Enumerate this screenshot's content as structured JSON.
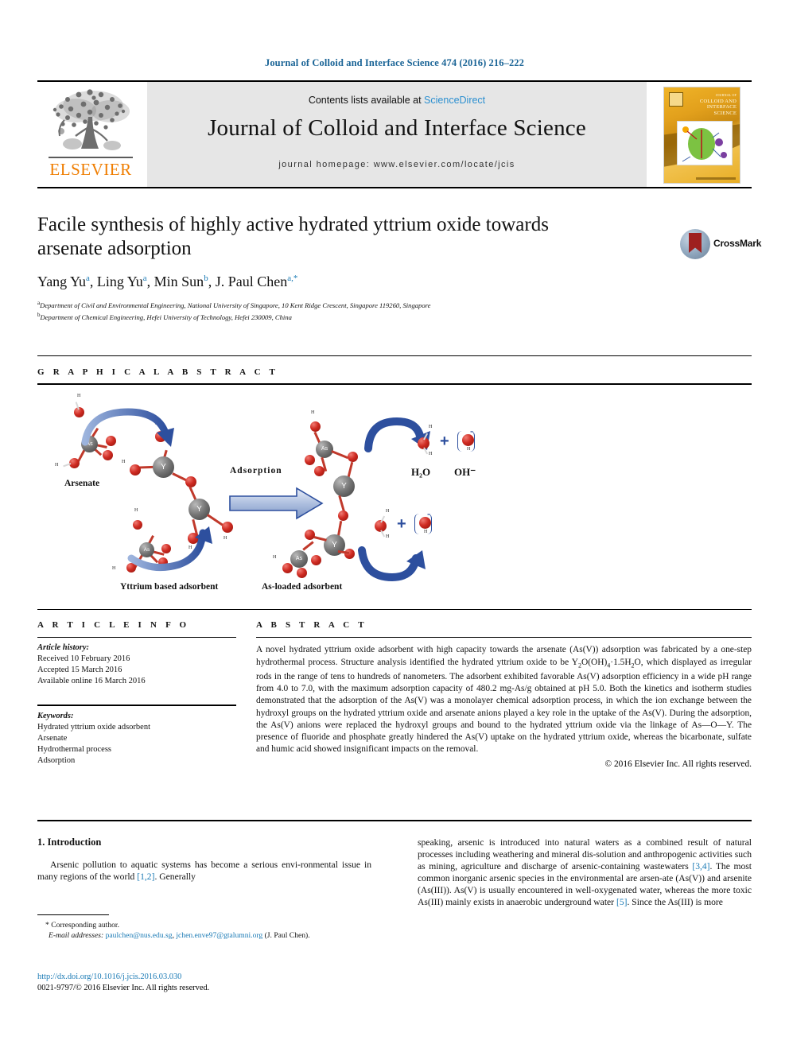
{
  "running_head": "Journal of Colloid and Interface Science 474 (2016) 216–222",
  "masthead": {
    "contents_prefix": "Contents lists available at ",
    "sciencedirect": "ScienceDirect",
    "journal_title": "Journal of Colloid and Interface Science",
    "homepage": "journal homepage: www.elsevier.com/locate/jcis",
    "publisher_wordmark": "ELSEVIER",
    "cover_title_line1": "JOURNAL OF",
    "cover_title_line2": "COLLOID AND",
    "cover_title_line3": "INTERFACE",
    "cover_title_line4": "SCIENCE"
  },
  "article": {
    "title": "Facile synthesis of highly active hydrated yttrium oxide towards arsenate adsorption",
    "authors": [
      {
        "name": "Yang Yu",
        "sup": "a"
      },
      {
        "name": "Ling Yu",
        "sup": "a"
      },
      {
        "name": "Min Sun",
        "sup": "b"
      },
      {
        "name": "J. Paul Chen",
        "sup": "a,*"
      }
    ],
    "affiliations": [
      {
        "mark": "a",
        "text": "Department of Civil and Environmental Engineering, National University of Singapore, 10 Kent Ridge Crescent, Singapore 119260, Singapore"
      },
      {
        "mark": "b",
        "text": "Department of Chemical Engineering, Hefei University of Technology, Hefei 230009, China"
      }
    ],
    "crossmark_label": "CrossMark"
  },
  "graphical_abstract": {
    "heading": "G R A P H I C A L   A B S T R A C T",
    "labels": {
      "arsenate": "Arsenate",
      "adsorbent": "Yttrium based adsorbent",
      "adsorption": "Adsorption",
      "loaded": "As-loaded adsorbent",
      "water": "H₂O",
      "hydroxide": "OH⁻",
      "atom_as": "As",
      "atom_y": "Y",
      "atom_h": "H",
      "atom_o": "O",
      "plus": "+",
      "minus": "-"
    }
  },
  "article_info": {
    "heading": "A R T I C L E   I N F O",
    "history_label": "Article history:",
    "history": [
      "Received 10 February 2016",
      "Accepted 15 March 2016",
      "Available online 16 March 2016"
    ],
    "keywords_label": "Keywords:",
    "keywords": [
      "Hydrated yttrium oxide adsorbent",
      "Arsenate",
      "Hydrothermal process",
      "Adsorption"
    ]
  },
  "abstract": {
    "heading": "A B S T R A C T",
    "part1": "A novel hydrated yttrium oxide adsorbent with high capacity towards the arsenate (As(V)) adsorption was fabricated by a one-step hydrothermal process. Structure analysis identified the hydrated yttrium oxide to be Y",
    "formula_1": "2",
    "part2": "O(OH)",
    "formula_2": "4",
    "part3": "·1.5H",
    "formula_3": "2",
    "part4": "O, which displayed as irregular rods in the range of tens to hundreds of nanometers. The adsorbent exhibited favorable As(V) adsorption efficiency in a wide pH range from 4.0 to 7.0, with the maximum adsorption capacity of 480.2 mg-As/g obtained at pH 5.0. Both the kinetics and isotherm studies demonstrated that the adsorption of the As(V) was a monolayer chemical adsorption process, in which the ion exchange between the hydroxyl groups on the hydrated yttrium oxide and arsenate anions played a key role in the uptake of the As(V). During the adsorption, the As(V) anions were replaced the hydroxyl groups and bound to the hydrated yttrium oxide via the linkage of As—O—Y. The presence of fluoride and phosphate greatly hindered the As(V) uptake on the hydrated yttrium oxide, whereas the bicarbonate, sulfate and humic acid showed insignificant impacts on the removal.",
    "copyright": "© 2016 Elsevier Inc. All rights reserved."
  },
  "body": {
    "section_heading": "1. Introduction",
    "left_para_a": "Arsenic pollution to aquatic systems has become a serious envi-ronmental issue in many regions of the world ",
    "left_ref_1": "[1,2]",
    "left_para_b": ". Generally",
    "right_text_a": "speaking, arsenic is introduced into natural waters as a combined result of natural processes including weathering and mineral dis-solution and anthropogenic activities such as mining, agriculture and discharge of arsenic-containing wastewaters ",
    "right_ref_1": "[3,4]",
    "right_text_b": ". The most common inorganic arsenic species in the environmental are arsen-ate (As(V)) and arsenite (As(III)). As(V) is usually encountered in well-oxygenated water, whereas the more toxic As(III) mainly exists in anaerobic underground water ",
    "right_ref_2": "[5]",
    "right_text_c": ". Since the As(III) is more"
  },
  "footnote": {
    "corresponding": "* Corresponding author.",
    "email_label": "E-mail addresses:",
    "email_1": "paulchen@nus.edu.sg",
    "email_sep": ", ",
    "email_2": "jchen.enve97@gtalumni.org",
    "email_tail": " (J. Paul Chen)."
  },
  "doi": {
    "url": "http://dx.doi.org/10.1016/j.jcis.2016.03.030",
    "issn": "0021-9797/© 2016 Elsevier Inc. All rights reserved."
  },
  "colors": {
    "link": "#1a7ab5",
    "elsevier_orange": "#ef7d00",
    "sciencedirect": "#2b8fd0",
    "oxygen_red": "#cf2b22",
    "metal_gray": "#757575",
    "arrow_blue": "#2d4f9e"
  }
}
